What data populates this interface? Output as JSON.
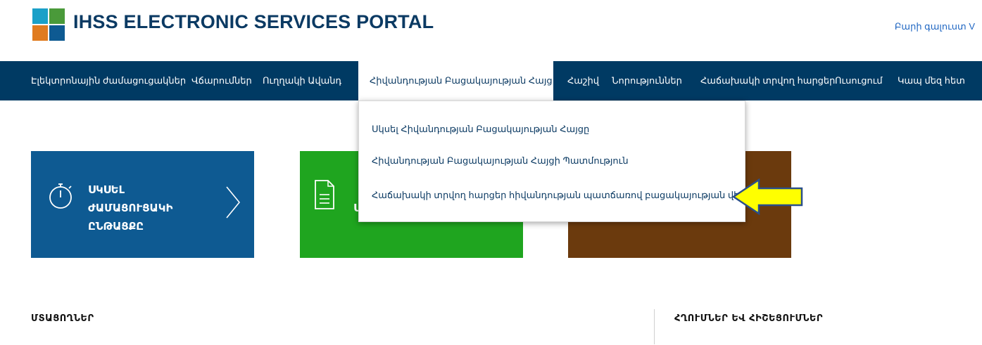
{
  "header": {
    "title": "IHSS ELECTRONIC SERVICES PORTAL",
    "welcome": "Բարի գալուստ V",
    "logo_colors": [
      "#1aa0c8",
      "#4a9a3a",
      "#e07b1f",
      "#0e5a92"
    ]
  },
  "nav": {
    "items": [
      {
        "label": "Էլեկտրոնային ժամացուցակներ"
      },
      {
        "label": "Վճարումներ"
      },
      {
        "label": "Ուղղակի Ավանդ"
      },
      {
        "label": "Հիվանդության Բացակայության Հայց"
      },
      {
        "label": "Հաշիվ"
      },
      {
        "label": "Նորություններ"
      },
      {
        "label": "Հաճախակի տրվող հարցեր"
      },
      {
        "label": "Ուսուցում"
      },
      {
        "label": "Կապ մեզ հետ"
      }
    ],
    "active_index": 3
  },
  "dropdown": {
    "items": [
      {
        "label": "Սկսել Հիվանդության Բացակայության Հայցը"
      },
      {
        "label": "Հիվանդության Բացակայության Հայցի Պատմություն"
      },
      {
        "label": "Հաճախակի տրվող հարցեր հիվանդության պատճառով բացակայության վերաբերյալ"
      }
    ]
  },
  "tiles": {
    "blue": {
      "line1": "ՍԿՍԵԼ",
      "line2": "ԺԱՄԱՑՈՒՑԱԿԻ",
      "line3": "ԸՆԹԱՑՔԸ"
    },
    "green": {
      "visible_text": "Ս"
    },
    "colors": {
      "blue": "#0e5a92",
      "green": "#1fa51f",
      "brown": "#6b3a0d"
    }
  },
  "sections": {
    "left": "ՄՏԱՑՈՂՆԵՐ",
    "right": "ՀՂՈՒՄՆԵՐ ԵՎ ՀԻՇԵՑՈՒՄՆԵՐ"
  },
  "annotation": {
    "arrow_color": "#ffff00"
  }
}
